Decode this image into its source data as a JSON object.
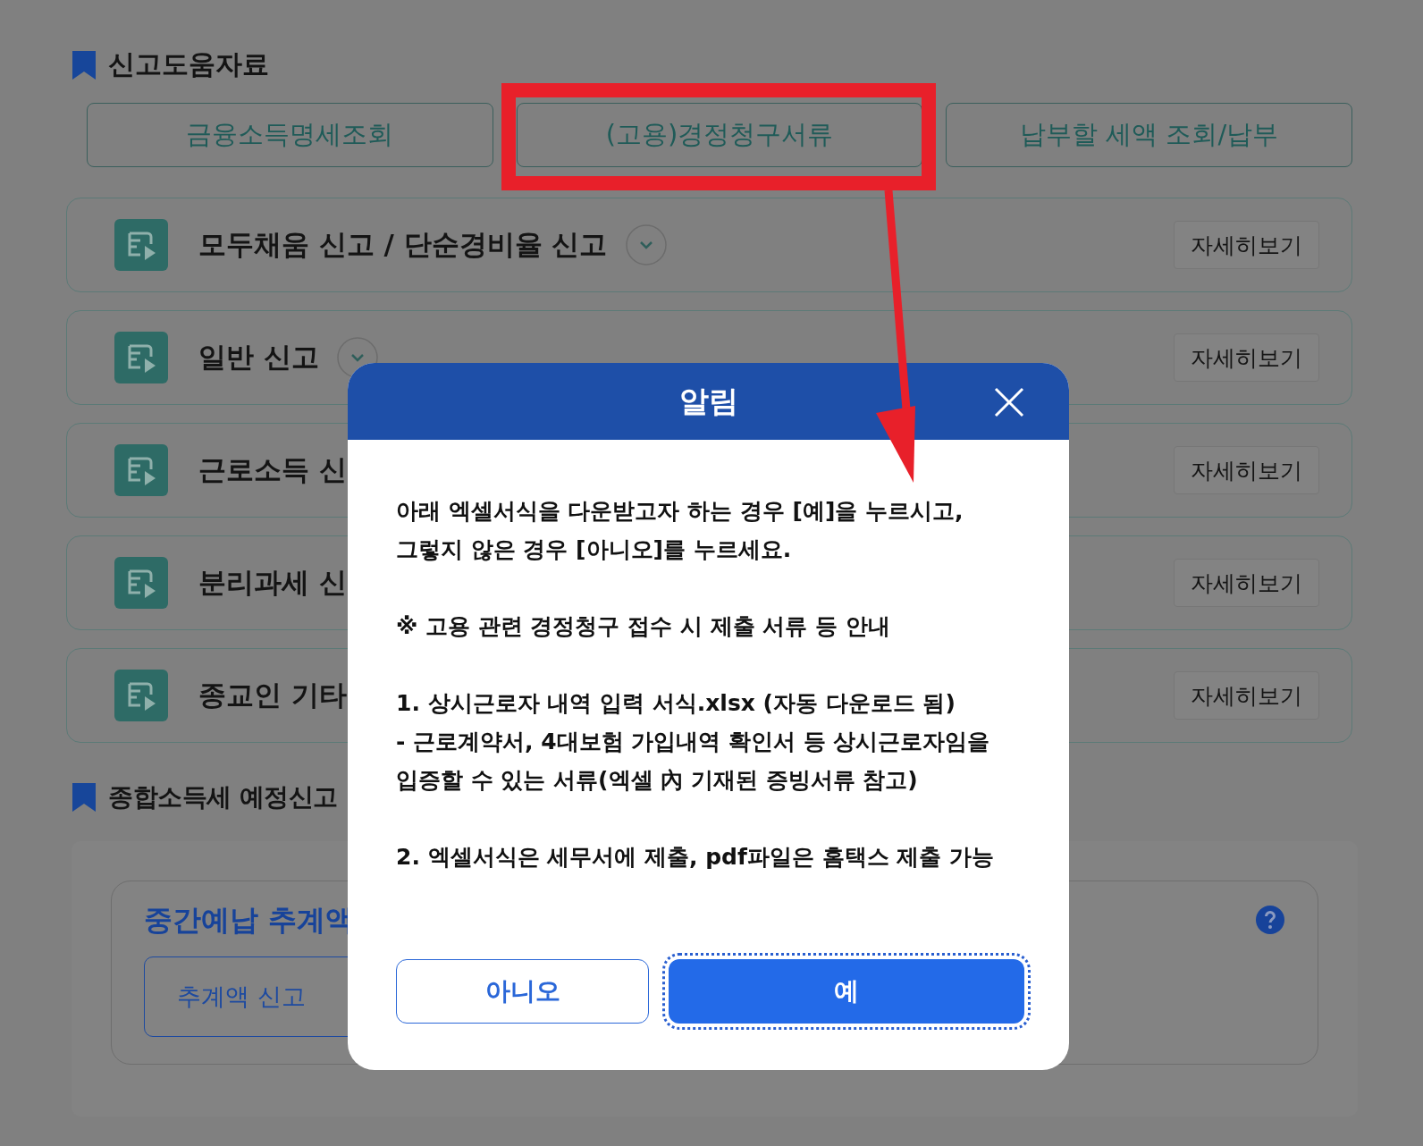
{
  "help_section": {
    "title": "신고도움자료",
    "links": [
      "금융소득명세조회",
      "(고용)경정청구서류",
      "납부할 세액 조회/납부"
    ]
  },
  "rows": [
    {
      "title": "모두채움 신고 / 단순경비율 신고",
      "kind": "expandable",
      "button": "자세히보기"
    },
    {
      "title": "일반 신고",
      "kind": "expandable",
      "button": "자세히보기"
    },
    {
      "title": "근로소득 신",
      "kind": "plain",
      "button": "자세히보기"
    },
    {
      "title": "분리과세 신",
      "kind": "plain",
      "button": "자세히보기"
    },
    {
      "title": "종교인 기타",
      "kind": "plain",
      "button": "자세히보기"
    }
  ],
  "forecast_section": {
    "title": "종합소득세 예정신고",
    "card": {
      "title": "중간예납 추계액",
      "button": "추계액 신고"
    }
  },
  "dialog": {
    "title": "알림",
    "paragraphs": [
      "아래 엑셀서식을 다운받고자 하는 경우 [예]을 누르시고,\n그렇지 않은 경우 [아니오]를 누르세요.",
      "※ 고용 관련 경정청구 접수 시 제출 서류 등 안내",
      "1. 상시근로자 내역 입력 서식.xlsx (자동 다운로드 됨)\n- 근로계약서, 4대보험 가입내역 확인서 등 상시근로자임을\n입증할 수 있는 서류(엑셀 內 기재된 증빙서류 참고)",
      "2. 엑셀서식은 세무서에 제출, pdf파일은 홈택스 제출 가능"
    ],
    "buttons": [
      {
        "label": "아니오",
        "kind": "secondary",
        "focused": false
      },
      {
        "label": "예",
        "kind": "primary",
        "focused": true
      }
    ]
  }
}
